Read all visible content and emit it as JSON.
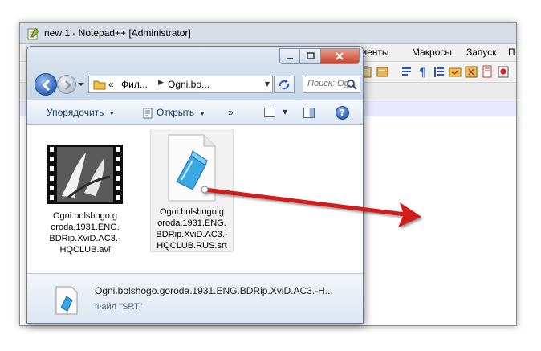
{
  "notepad": {
    "title": "new 1 - Notepad++ [Administrator]",
    "menus": [
      "ументы",
      "Макросы",
      "Запуск",
      "П"
    ]
  },
  "explorer": {
    "breadcrumb": [
      "«",
      "Фил...",
      "Ogni.bo..."
    ],
    "search_placeholder": "Поиск: Og...",
    "commands": {
      "organize": "Упорядочить",
      "open": "Открыть",
      "more": "»",
      "help": "?"
    },
    "files": [
      {
        "name_lines": [
          "Ogni.bolshogo.g",
          "oroda.1931.ENG.",
          "BDRip.XviD.AC3.-",
          "HQCLUB.avi"
        ],
        "icon": "video-thumbnail-icon",
        "selected": false
      },
      {
        "name_lines": [
          "Ogni.bolshogo.g",
          "oroda.1931.ENG.",
          "BDRip.XviD.AC3.-",
          "HQCLUB.RUS.srt"
        ],
        "icon": "notepad-document-icon",
        "selected": true
      }
    ],
    "details": {
      "name": "Ogni.bolshogo.goroda.1931.ENG.BDRip.XviD.AC3.-H...",
      "type": "Файл \"SRT\""
    }
  },
  "colors": {
    "arrow": "#d21f1f",
    "explorer_frame": "#cfdbea",
    "notepad_caret_line": "#e8e8ff"
  }
}
